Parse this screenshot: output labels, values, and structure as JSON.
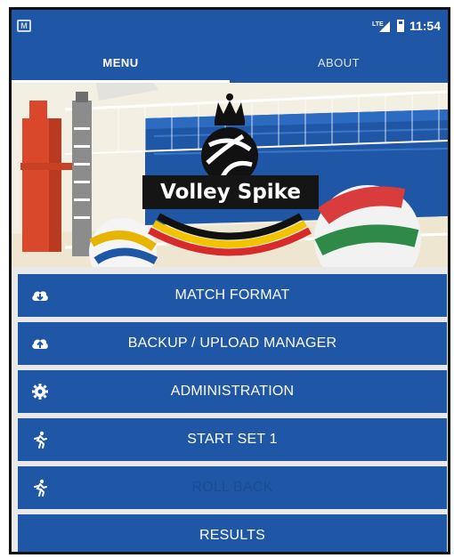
{
  "statusbar": {
    "notification_icon": "app-notification-icon",
    "time": "11:54"
  },
  "tabs": [
    {
      "label": "MENU",
      "active": true
    },
    {
      "label": "ABOUT",
      "active": false
    }
  ],
  "hero": {
    "logo_text": "Volley Spike"
  },
  "menu": {
    "items": [
      {
        "label": "MATCH FORMAT",
        "icon": "cloud-download-icon",
        "enabled": true
      },
      {
        "label": "BACKUP / UPLOAD MANAGER",
        "icon": "cloud-upload-icon",
        "enabled": true
      },
      {
        "label": "ADMINISTRATION",
        "icon": "gear-icon",
        "enabled": true
      },
      {
        "label": "START SET 1",
        "icon": "runner-icon",
        "enabled": true
      },
      {
        "label": "ROLL BACK",
        "icon": "runner-icon",
        "enabled": false
      },
      {
        "label": "RESULTS",
        "icon": "",
        "enabled": true
      }
    ]
  },
  "colors": {
    "primary": "#1f57a6",
    "disabled_text": "#1b4b92"
  }
}
